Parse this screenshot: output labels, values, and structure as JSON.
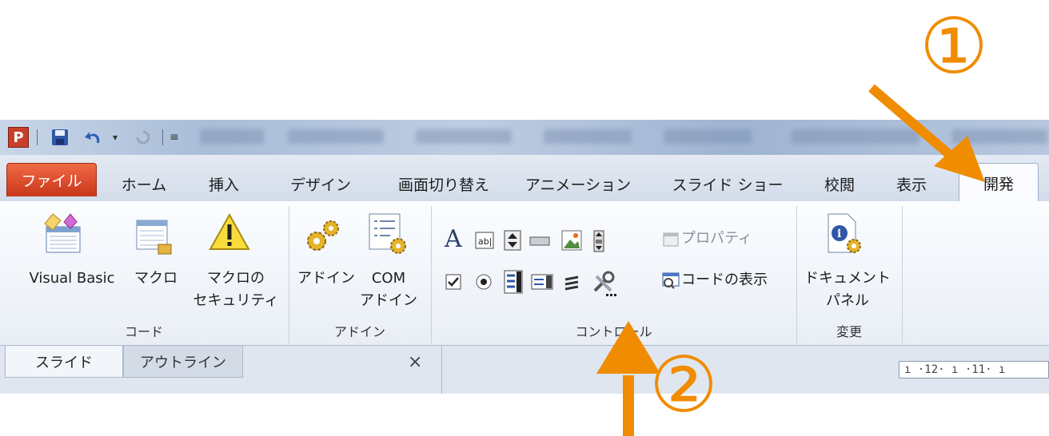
{
  "colors": {
    "annotation": "#f08c00",
    "file_tab": "#d9472a",
    "ribbon_bg": "#f4f7fb"
  },
  "quick_access": {
    "app_icon_letter": "P",
    "icons": [
      "save-icon",
      "undo-icon",
      "redo-icon",
      "customize-qat-icon"
    ]
  },
  "tabs": [
    "ファイル",
    "ホーム",
    "挿入",
    "デザイン",
    "画面切り替え",
    "アニメーション",
    "スライド ショー",
    "校閲",
    "表示",
    "開発"
  ],
  "ribbon": {
    "code_group": {
      "label": "コード",
      "visual_basic": "Visual Basic",
      "macro": "マクロ",
      "macro_security_line1": "マクロの",
      "macro_security_line2": "セキュリティ"
    },
    "addin_group": {
      "label": "アドイン",
      "addin": "アドイン",
      "com_addin_line1": "COM",
      "com_addin_line2": "アドイン"
    },
    "controls_group": {
      "label": "コントロール",
      "properties": "プロパティ",
      "view_code": "コードの表示"
    },
    "modify_group": {
      "label": "変更",
      "doc_panel_line1": "ドキュメント",
      "doc_panel_line2": "パネル"
    }
  },
  "pane": {
    "tab_slide": "スライド",
    "tab_outline": "アウトライン",
    "close": "×"
  },
  "ruler_text": "ı ·12· ı ·11· ı",
  "annotations": {
    "one": "①",
    "two": "②"
  }
}
